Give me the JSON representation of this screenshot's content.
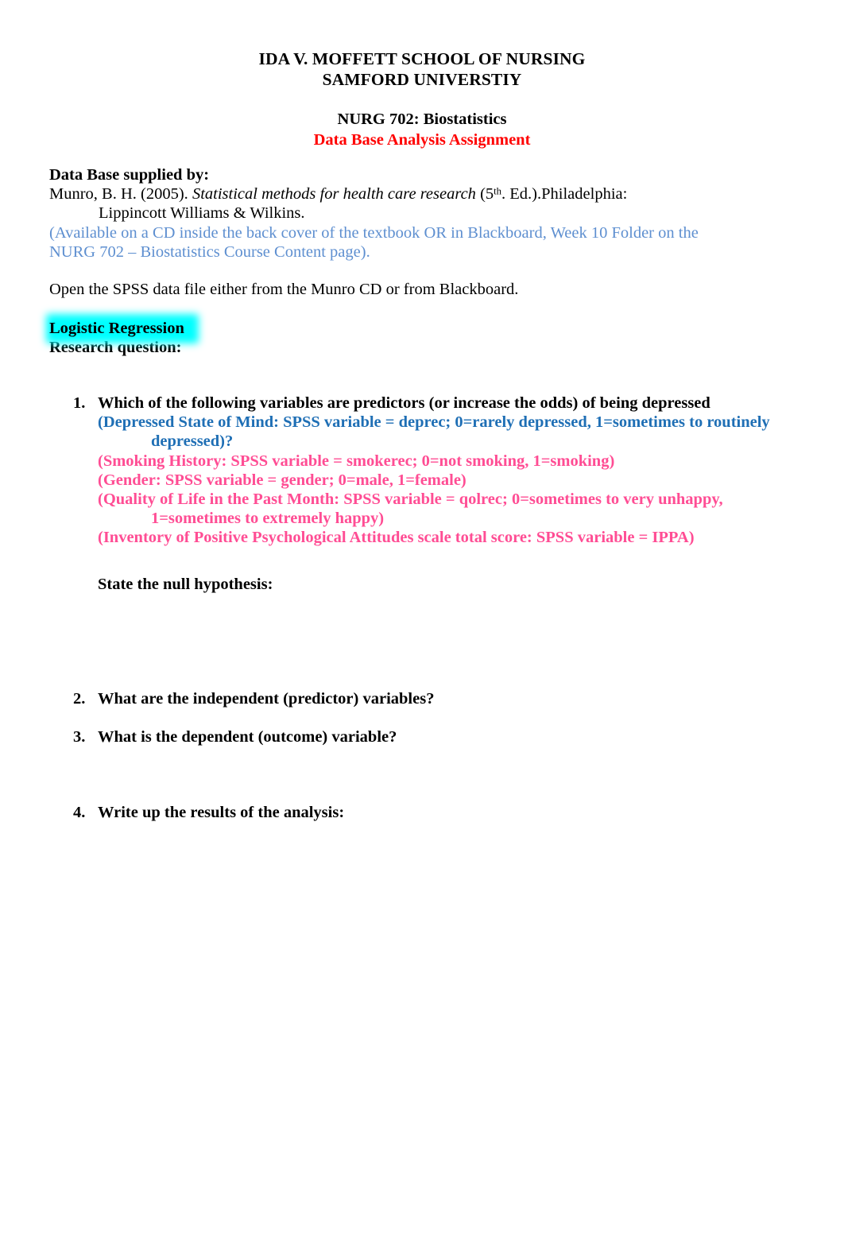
{
  "document": {
    "header": {
      "institution_line1": "IDA V. MOFFETT SCHOOL OF NURSING",
      "institution_line2": "SAMFORD UNIVERSTIY",
      "course": "NURG 702: Biostatistics",
      "assignment_title": "Data Base Analysis Assignment",
      "assignment_title_color": "#ff0000"
    },
    "source_section": {
      "label": "Data Base supplied by:",
      "citation_author_year": "Munro, B. H. (2005). ",
      "citation_title_italic": "Statistical methods for health care research",
      "citation_edition_prefix": " (5",
      "citation_edition_sup": "th",
      "citation_edition_suffix": ". Ed.).Philadelphia:",
      "citation_publisher": "Lippincott Williams & Wilkins.",
      "availability_line1": "(Available on a CD inside the back cover of the textbook OR in Blackboard, Week 10 Folder on the",
      "availability_line2": "NURG 702 – Biostatistics Course Content page).",
      "availability_color": "#5e8fd0"
    },
    "instruction": "Open the SPSS data file either from the Munro CD or from Blackboard.",
    "analysis_heading": {
      "text": "Logistic Regression",
      "highlight_color": "#00ffff"
    },
    "research_question_label": "Research question:",
    "questions": [
      {
        "number": "1.",
        "text": "Which of the following variables are predictors (or increase the odds) of being depressed",
        "sublines": [
          {
            "text": "(Depressed State of Mind: SPSS variable = deprec; 0=rarely depressed, 1=sometimes to routinely",
            "color": "#1f6fb5",
            "indent": false
          },
          {
            "text": "depressed)?",
            "color": "#1f6fb5",
            "indent": true
          },
          {
            "text": "(Smoking History: SPSS variable = smokerec; 0=not smoking, 1=smoking)",
            "color": "#ff4d94",
            "indent": false
          },
          {
            "text": "(Gender: SPSS variable = gender; 0=male, 1=female)",
            "color": "#ff4d94",
            "indent": false
          },
          {
            "text": "(Quality of Life in the Past Month: SPSS variable = qolrec; 0=sometimes to very unhappy,",
            "color": "#ff4d94",
            "indent": false
          },
          {
            "text": "1=sometimes to extremely happy)",
            "color": "#ff4d94",
            "indent": true
          },
          {
            "text": "(Inventory of Positive Psychological Attitudes scale total score: SPSS variable = IPPA)",
            "color": "#ff4d94",
            "indent": false
          }
        ],
        "followup": "State the null hypothesis:"
      },
      {
        "number": "2.",
        "text": "What are the independent (predictor) variables?"
      },
      {
        "number": "3.",
        "text": "What is the dependent (outcome) variable?"
      },
      {
        "number": "4.",
        "text": "Write up the results of the analysis:"
      }
    ]
  }
}
